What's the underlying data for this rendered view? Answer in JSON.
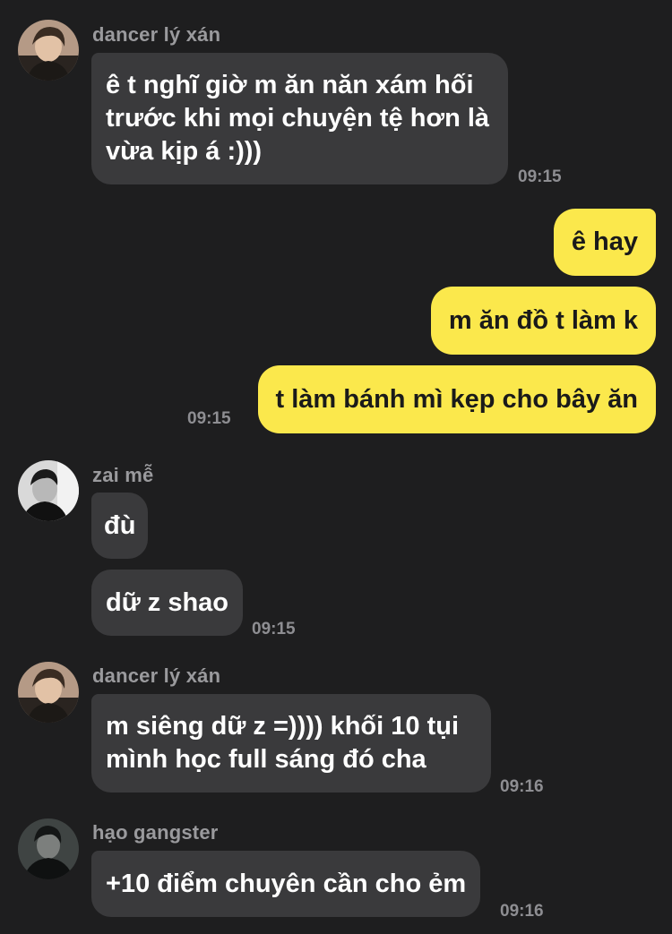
{
  "messages": {
    "g1": {
      "sender": "dancer lý xán",
      "lines": [
        "ê t nghĩ giờ m ăn năn xám hối",
        "trước khi mọi chuyện tệ hơn là",
        "vừa kịp á :)))"
      ],
      "time": "09:15"
    },
    "me": {
      "m1": "ê hay",
      "m2": "m ăn đồ t làm k",
      "m3": "t làm bánh mì kẹp cho bây ăn",
      "time": "09:15"
    },
    "g2": {
      "sender": "zai mễ",
      "m1": "đù",
      "m2": "dữ z shao",
      "time": "09:15"
    },
    "g3": {
      "sender": "dancer lý xán",
      "lines": [
        "m siêng dữ z =)))) khối 10 tụi",
        "mình học full sáng đó cha"
      ],
      "time": "09:16"
    },
    "g4": {
      "sender": "hạo gangster",
      "m1": "+10 điểm chuyên cần cho ẻm",
      "time": "09:16"
    }
  }
}
